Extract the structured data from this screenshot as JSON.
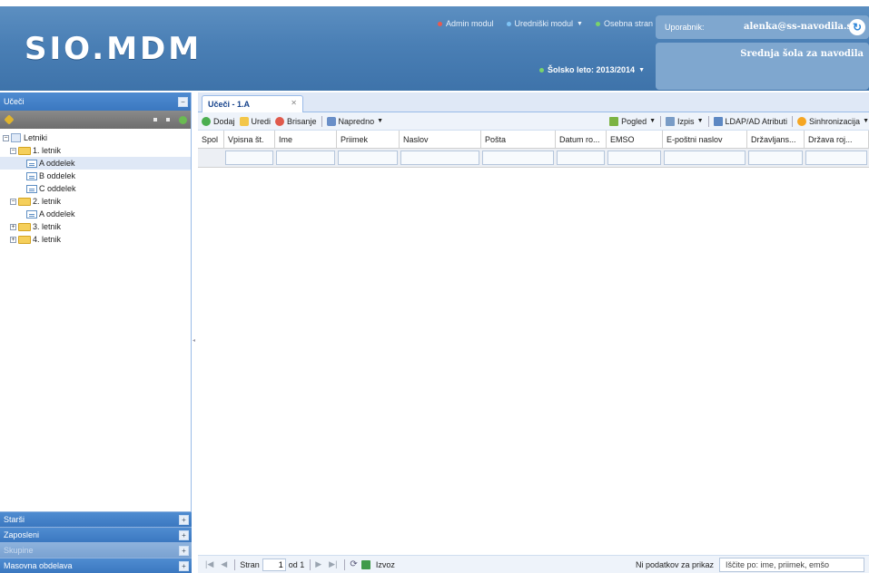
{
  "header": {
    "logo": "SIO.MDM",
    "nav": [
      {
        "label": "Admin modul",
        "dot": "#e85a4f",
        "dropdown": false
      },
      {
        "label": "Uredniški modul",
        "dot": "#7ec3f5",
        "dropdown": true
      },
      {
        "label": "Osebna stran",
        "dot": "#7ad36a",
        "dropdown": false
      }
    ],
    "school_year": "Šolsko leto: 2013/2014",
    "user_label": "Uporabnik:",
    "user_email": "alenka@ss-navodila.si",
    "school_name": "Srednja šola za navodila"
  },
  "left_panel": {
    "title": "Učeči",
    "tree": [
      {
        "label": "Letniki",
        "level": 0,
        "type": "root",
        "expander": "-"
      },
      {
        "label": "1. letnik",
        "level": 1,
        "type": "folder",
        "expander": "-"
      },
      {
        "label": "A oddelek",
        "level": 2,
        "type": "class",
        "selected": true
      },
      {
        "label": "B oddelek",
        "level": 2,
        "type": "class"
      },
      {
        "label": "C oddelek",
        "level": 2,
        "type": "class"
      },
      {
        "label": "2. letnik",
        "level": 1,
        "type": "folder",
        "expander": "-"
      },
      {
        "label": "A oddelek",
        "level": 2,
        "type": "class"
      },
      {
        "label": "3. letnik",
        "level": 1,
        "type": "folder",
        "expander": "+"
      },
      {
        "label": "4. letnik",
        "level": 1,
        "type": "folder",
        "expander": "+"
      }
    ],
    "collapsed_panels": [
      {
        "label": "Starši",
        "disabled": false
      },
      {
        "label": "Zaposleni",
        "disabled": false
      },
      {
        "label": "Skupine",
        "disabled": true
      },
      {
        "label": "Masovna obdelava",
        "disabled": false
      }
    ]
  },
  "main": {
    "tab_label": "Učeči - 1.A",
    "toolbar": {
      "add": "Dodaj",
      "edit": "Uredi",
      "delete": "Brisanje",
      "advanced": "Napredno",
      "view": "Pogled",
      "print": "Izpis",
      "ldap": "LDAP/AD Atributi",
      "sync": "Sinhronizacija"
    },
    "columns": [
      {
        "label": "Spol"
      },
      {
        "label": "Vpisna št."
      },
      {
        "label": "Ime"
      },
      {
        "label": "Priimek"
      },
      {
        "label": "Naslov"
      },
      {
        "label": "Pošta"
      },
      {
        "label": "Datum ro..."
      },
      {
        "label": "EMSO"
      },
      {
        "label": "E-poštni naslov"
      },
      {
        "label": "Državljans..."
      },
      {
        "label": "Država roj..."
      }
    ],
    "pager": {
      "page_label": "Stran",
      "page_value": "1",
      "of_label": "od 1",
      "export": "Izvoz",
      "no_data": "Ni podatkov za prikaz",
      "search_hint": "Iščite po: ime, priimek, emšo"
    }
  }
}
